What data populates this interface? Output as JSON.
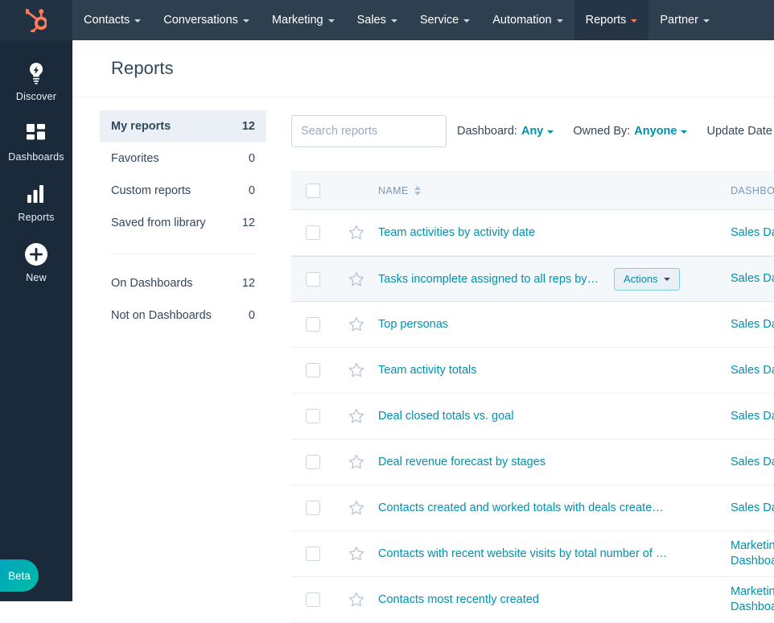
{
  "topnav": {
    "logo": "hubspot-sprocket-logo",
    "items": [
      {
        "label": "Contacts",
        "active": false
      },
      {
        "label": "Conversations",
        "active": false
      },
      {
        "label": "Marketing",
        "active": false
      },
      {
        "label": "Sales",
        "active": false
      },
      {
        "label": "Service",
        "active": false
      },
      {
        "label": "Automation",
        "active": false
      },
      {
        "label": "Reports",
        "active": true
      },
      {
        "label": "Partner",
        "active": false
      }
    ]
  },
  "rail": {
    "items": [
      {
        "label": "Discover",
        "icon": "lightbulb-icon"
      },
      {
        "label": "Dashboards",
        "icon": "grid-icon"
      },
      {
        "label": "Reports",
        "icon": "bar-chart-icon"
      },
      {
        "label": "New",
        "icon": "plus-circle-icon"
      }
    ],
    "beta_label": "Beta"
  },
  "header": {
    "title": "Reports"
  },
  "filters": {
    "primary": [
      {
        "label": "My reports",
        "count": "12",
        "active": true
      },
      {
        "label": "Favorites",
        "count": "0",
        "active": false
      },
      {
        "label": "Custom reports",
        "count": "0",
        "active": false
      },
      {
        "label": "Saved from library",
        "count": "12",
        "active": false
      }
    ],
    "secondary": [
      {
        "label": "On Dashboards",
        "count": "12",
        "active": false
      },
      {
        "label": "Not on Dashboards",
        "count": "0",
        "active": false
      }
    ]
  },
  "search": {
    "placeholder": "Search reports",
    "value": "",
    "icon": "search-icon"
  },
  "dropdowns": [
    {
      "label": "Dashboard:",
      "value": "Any"
    },
    {
      "label": "Owned By:",
      "value": "Anyone"
    },
    {
      "label": "Update Date",
      "value": ""
    }
  ],
  "table": {
    "columns": {
      "name": "NAME",
      "dashboard": "DASHBOARD"
    },
    "actions_label": "Actions",
    "rows": [
      {
        "name": "Team activities by activity date",
        "dashboard": "Sales Dashboard",
        "hover": false,
        "two_line": false
      },
      {
        "name": "Tasks incomplete assigned to all reps by…",
        "dashboard": "Sales Dashboard",
        "hover": true,
        "two_line": false
      },
      {
        "name": "Top personas",
        "dashboard": "Sales Dashboard",
        "hover": false,
        "two_line": false
      },
      {
        "name": "Team activity totals",
        "dashboard": "Sales Dashboard",
        "hover": false,
        "two_line": false
      },
      {
        "name": "Deal closed totals vs. goal",
        "dashboard": "Sales Dashboard",
        "hover": false,
        "two_line": false
      },
      {
        "name": "Deal revenue forecast by stages",
        "dashboard": "Sales Dashboard",
        "hover": false,
        "two_line": false
      },
      {
        "name": "Contacts created and worked totals with deals create…",
        "dashboard": "Sales Dashboard",
        "hover": false,
        "two_line": false
      },
      {
        "name": "Contacts with recent website visits by total number of …",
        "dashboard": "Marketing Dashboard",
        "hover": false,
        "two_line": true
      },
      {
        "name": "Contacts most recently created",
        "dashboard": "Marketing Dashboard",
        "hover": false,
        "two_line": true
      }
    ]
  },
  "colors": {
    "nav_bg": "#2e3f50",
    "rail_bg": "#1b2a3a",
    "brand_orange": "#ff7a59",
    "link_teal": "#0091ae",
    "text": "#33475b",
    "row_hover": "#f5f8fa",
    "beta_gradient_start": "#00a4bd",
    "beta_gradient_end": "#00bda5"
  }
}
